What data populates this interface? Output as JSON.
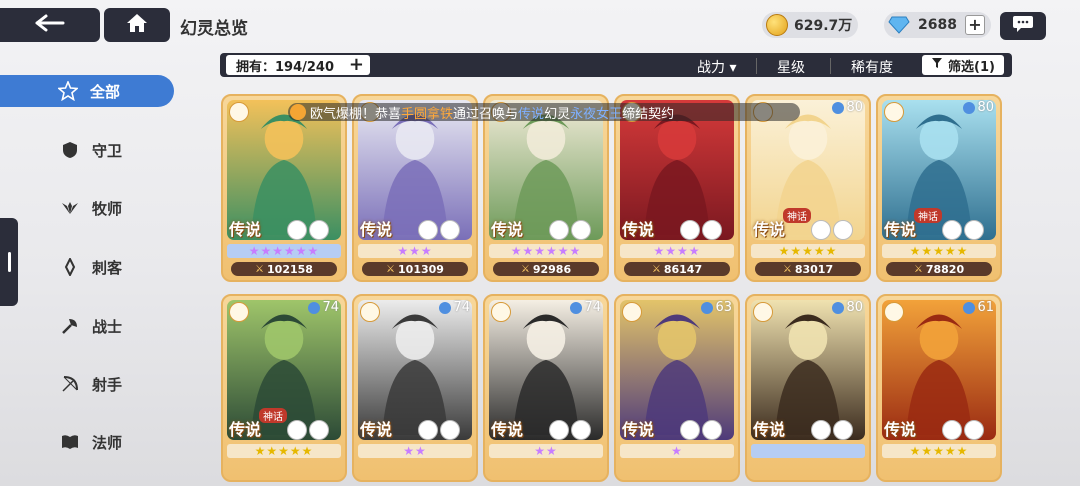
{
  "header": {
    "title": "幻灵总览"
  },
  "resources": {
    "gold": "629.7万",
    "gems": "2688"
  },
  "filter": {
    "owned": "拥有：194/240",
    "sort_power": "战力 ▾",
    "sort_star": "星级",
    "sort_rarity": "稀有度",
    "filter_label": "筛选(1)"
  },
  "sidebar": {
    "items": [
      {
        "label": "全部",
        "icon": "star-outline-icon"
      },
      {
        "label": "守卫",
        "icon": "shield-icon"
      },
      {
        "label": "牧师",
        "icon": "wings-icon"
      },
      {
        "label": "刺客",
        "icon": "dagger-icon"
      },
      {
        "label": "战士",
        "icon": "axe-icon"
      },
      {
        "label": "射手",
        "icon": "bow-icon"
      },
      {
        "label": "法师",
        "icon": "book-icon"
      }
    ]
  },
  "ticker": {
    "prefix": "欧气爆棚！恭喜",
    "player": "手圆拿铁",
    "mid": "通过召唤与",
    "rarity": "传说",
    "spirit_pre": "幻灵",
    "spirit": "永夜女王",
    "suffix": "缔结契约"
  },
  "cards": [
    {
      "rarity": "传说",
      "power": "102158",
      "level": "",
      "myth": "",
      "stars": "★★★★★★",
      "starbar": "#b6cdf3",
      "starColor": "#c77dff",
      "art1": "#3b8f62",
      "art2": "#f3c15a"
    },
    {
      "rarity": "传说",
      "power": "101309",
      "level": "",
      "myth": "",
      "stars": "★★★",
      "starbar": "#f6e6c8",
      "starColor": "#c77dff",
      "art1": "#7a6fb8",
      "art2": "#e8e8f2"
    },
    {
      "rarity": "传说",
      "power": "92986",
      "level": "",
      "myth": "",
      "stars": "★★★★★★",
      "starbar": "#f6e6c8",
      "starColor": "#c77dff",
      "art1": "#6d9a59",
      "art2": "#f1ebd8"
    },
    {
      "rarity": "传说",
      "power": "86147",
      "level": "",
      "myth": "",
      "stars": "★★★★",
      "starbar": "#f6e6c8",
      "starColor": "#c77dff",
      "art1": "#7a1820",
      "art2": "#d63a3a"
    },
    {
      "rarity": "传说",
      "power": "83017",
      "level": "80",
      "myth": "神话",
      "stars": "★★★★★",
      "starbar": "#f6e6c8",
      "starColor": "#e6b800",
      "art1": "#f2d48e",
      "art2": "#fbf1d8"
    },
    {
      "rarity": "传说",
      "power": "78820",
      "level": "80",
      "myth": "神话",
      "stars": "★★★★★",
      "starbar": "#f6e6c8",
      "starColor": "#e6b800",
      "art1": "#2f6f8f",
      "art2": "#a9e0ef"
    },
    {
      "rarity": "传说",
      "power": "",
      "level": "74",
      "myth": "神话",
      "stars": "★★★★★",
      "starbar": "#f6e6c8",
      "starColor": "#e6b800",
      "art1": "#2c4a36",
      "art2": "#9fc56a"
    },
    {
      "rarity": "传说",
      "power": "",
      "level": "74",
      "myth": "",
      "stars": "★★",
      "starbar": "#f6e6c8",
      "starColor": "#c77dff",
      "art1": "#3a3a3a",
      "art2": "#ececec"
    },
    {
      "rarity": "传说",
      "power": "",
      "level": "74",
      "myth": "",
      "stars": "★★",
      "starbar": "#f6e6c8",
      "starColor": "#c77dff",
      "art1": "#2a2a2a",
      "art2": "#f5efe4"
    },
    {
      "rarity": "传说",
      "power": "",
      "level": "63",
      "myth": "",
      "stars": "★",
      "starbar": "#f6e6c8",
      "starColor": "#c77dff",
      "art1": "#4e3a7a",
      "art2": "#e3c46a"
    },
    {
      "rarity": "传说",
      "power": "",
      "level": "80",
      "myth": "",
      "stars": "",
      "starbar": "#b6cdf3",
      "starColor": "#c77dff",
      "art1": "#3b2b1e",
      "art2": "#f0e2b0"
    },
    {
      "rarity": "传说",
      "power": "",
      "level": "61",
      "myth": "",
      "stars": "★★★★★",
      "starbar": "#f6e6c8",
      "starColor": "#e6b800",
      "art1": "#9a2a12",
      "art2": "#f2a23a"
    }
  ]
}
